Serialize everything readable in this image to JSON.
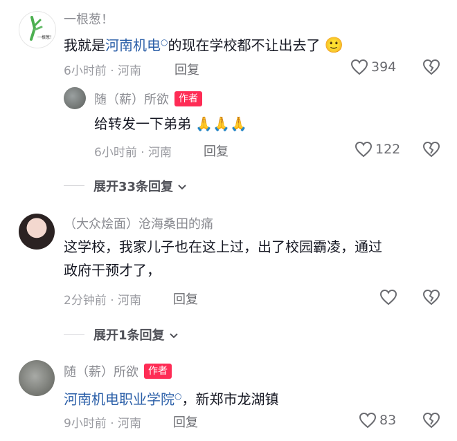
{
  "comments": [
    {
      "user": "一根葱！",
      "avatar_text": "一根葱！",
      "text_prefix": "我就是",
      "text_link": "河南机电",
      "text_suffix": "的现在学校都不让出去了",
      "emoji": "🙂",
      "time": "6小时前 · 河南",
      "reply_label": "回复",
      "likes": "394"
    },
    {
      "user": "随（薪）所欲",
      "badge": "作者",
      "text": "给转发一下弟弟",
      "emoji": "🙏🙏🙏",
      "time": "6小时前 · 河南",
      "reply_label": "回复",
      "likes": "122"
    },
    {
      "user": "（大众烩面）沧海桑田的痛",
      "text_line1": "这学校，我家儿子也在这上过，出了校园霸凌，通过",
      "text_line2": "政府干预才了，",
      "time": "2分钟前 · 河南",
      "reply_label": "回复"
    },
    {
      "user": "随（薪）所欲",
      "badge": "作者",
      "text_link": "河南机电职业学院",
      "text_suffix": "，新郑市龙湖镇",
      "time": "9小时前 · 河南",
      "reply_label": "回复",
      "likes": "83"
    }
  ],
  "expand": [
    {
      "label": "展开33条回复"
    },
    {
      "label": "展开1条回复"
    }
  ],
  "colors": {
    "author_badge": "#fe2c55",
    "link": "#2b5fa8"
  }
}
